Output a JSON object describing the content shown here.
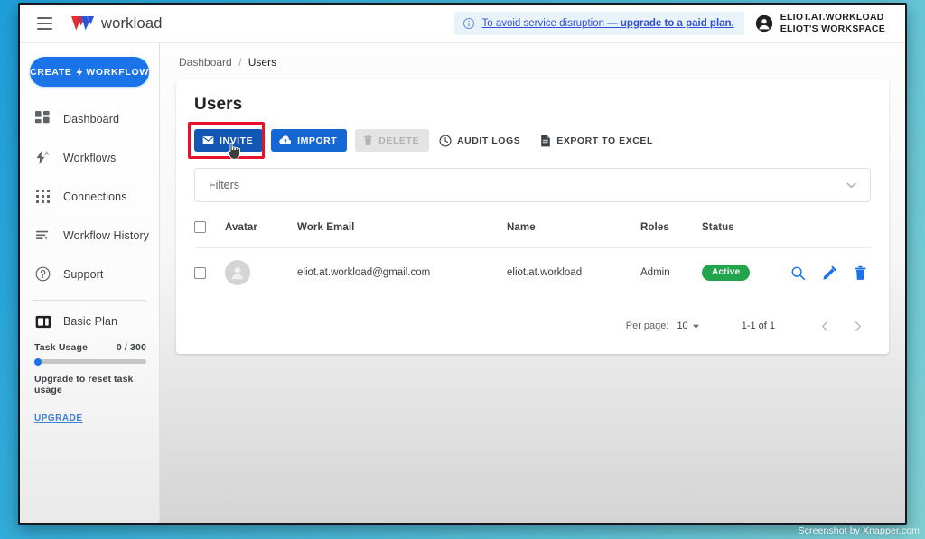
{
  "window": {
    "watermark": "Screenshot by Xnapper.com"
  },
  "topbar": {
    "menu_icon": "hamburger-menu-icon",
    "brand": "workload",
    "alert": {
      "icon": "info-circle-icon",
      "text_plain": "To avoid service disruption — ",
      "text_strong": "upgrade to a paid plan."
    },
    "user": {
      "icon": "account-circle-icon",
      "name": "ELIOT.AT.WORKLOAD",
      "workspace": "ELIOT'S WORKSPACE"
    }
  },
  "sidebar": {
    "create_button": {
      "label_left": "CREATE",
      "label_right": "WORKFLOW",
      "icon": "bolt-icon",
      "color": "#1a73e8"
    },
    "items": [
      {
        "label": "Dashboard",
        "icon": "dashboard-grid-icon"
      },
      {
        "label": "Workflows",
        "icon": "bolt-a-icon"
      },
      {
        "label": "Connections",
        "icon": "apps-dots-icon"
      },
      {
        "label": "Workflow History",
        "icon": "history-list-icon"
      },
      {
        "label": "Support",
        "icon": "help-circle-icon"
      }
    ],
    "plan": {
      "label": "Basic Plan",
      "icon": "plan-card-icon"
    },
    "usage": {
      "label": "Task Usage",
      "value": "0 / 300",
      "percent": 0,
      "note": "Upgrade to reset task usage",
      "upgrade_link": "UPGRADE"
    }
  },
  "main": {
    "breadcrumb": {
      "parent": "Dashboard",
      "separator": "/",
      "current": "Users"
    },
    "page_title": "Users",
    "toolbar": {
      "highlight_color": "#e8102a",
      "buttons": [
        {
          "label": "INVITE",
          "icon": "envelope-icon",
          "state": "hovered-highlighted"
        },
        {
          "label": "IMPORT",
          "icon": "cloud-upload-icon",
          "state": "primary"
        },
        {
          "label": "DELETE",
          "icon": "trash-icon",
          "state": "disabled"
        },
        {
          "label": "AUDIT LOGS",
          "icon": "clock-history-icon",
          "state": "plain"
        },
        {
          "label": "EXPORT TO EXCEL",
          "icon": "document-icon",
          "state": "plain"
        }
      ]
    },
    "filters": {
      "label": "Filters",
      "chevron_icon": "chevron-down-icon",
      "expanded": false
    },
    "table": {
      "select_all_checked": false,
      "columns": [
        "",
        "Avatar",
        "Work Email",
        "Name",
        "Roles",
        "Status",
        ""
      ],
      "rows": [
        {
          "checked": false,
          "avatar_icon": "person-avatar-icon",
          "email": "eliot.at.workload@gmail.com",
          "name": "eliot.at.workload",
          "role": "Admin",
          "status": "Active",
          "status_color": "#22a44c",
          "actions": [
            "search-icon",
            "edit-pencil-icon",
            "delete-trash-icon"
          ]
        }
      ]
    },
    "pagination": {
      "per_page_label": "Per page:",
      "per_page_value": "10",
      "range": "1-1 of 1",
      "prev_icon": "chevron-left-icon",
      "next_icon": "chevron-right-icon"
    }
  }
}
